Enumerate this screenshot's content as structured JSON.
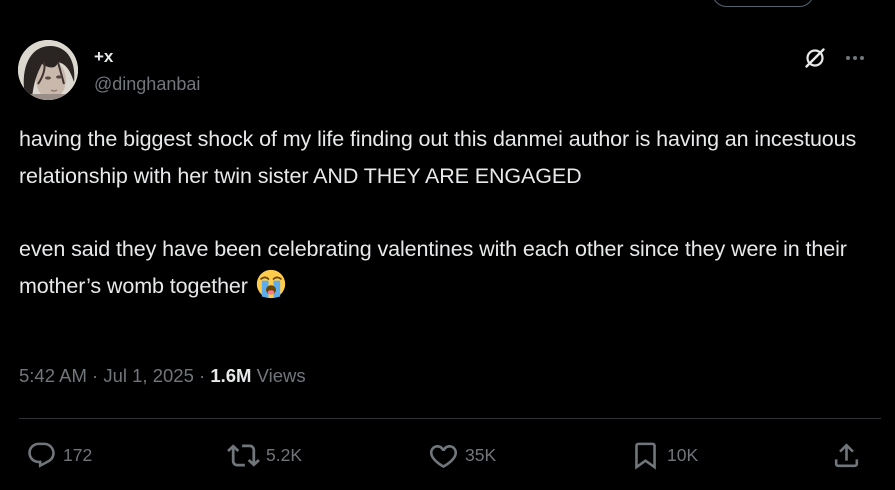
{
  "author": {
    "display_name": "+x",
    "handle": "@dinghanbai",
    "avatar_icon": "avatar-portrait"
  },
  "tweet": {
    "paragraph_1": "having the biggest shock of my life finding out this danmei author is having an incestuous relationship with her twin sister AND THEY ARE ENGAGED",
    "paragraph_2": "even said they have been celebrating valentines with each other since they were in their mother’s womb together",
    "emoji": "loudly-crying-face-emoji"
  },
  "meta": {
    "time": "5:42 AM",
    "separator": " · ",
    "date": "Jul 1, 2025",
    "views_count": "1.6M",
    "views_label": " Views"
  },
  "actions": {
    "replies": "172",
    "reposts": "5.2K",
    "likes": "35K",
    "bookmarks": "10K"
  },
  "colors": {
    "background": "#000000",
    "text_primary": "#e7e9ea",
    "text_secondary": "#71767b",
    "divider": "#2f3336"
  }
}
